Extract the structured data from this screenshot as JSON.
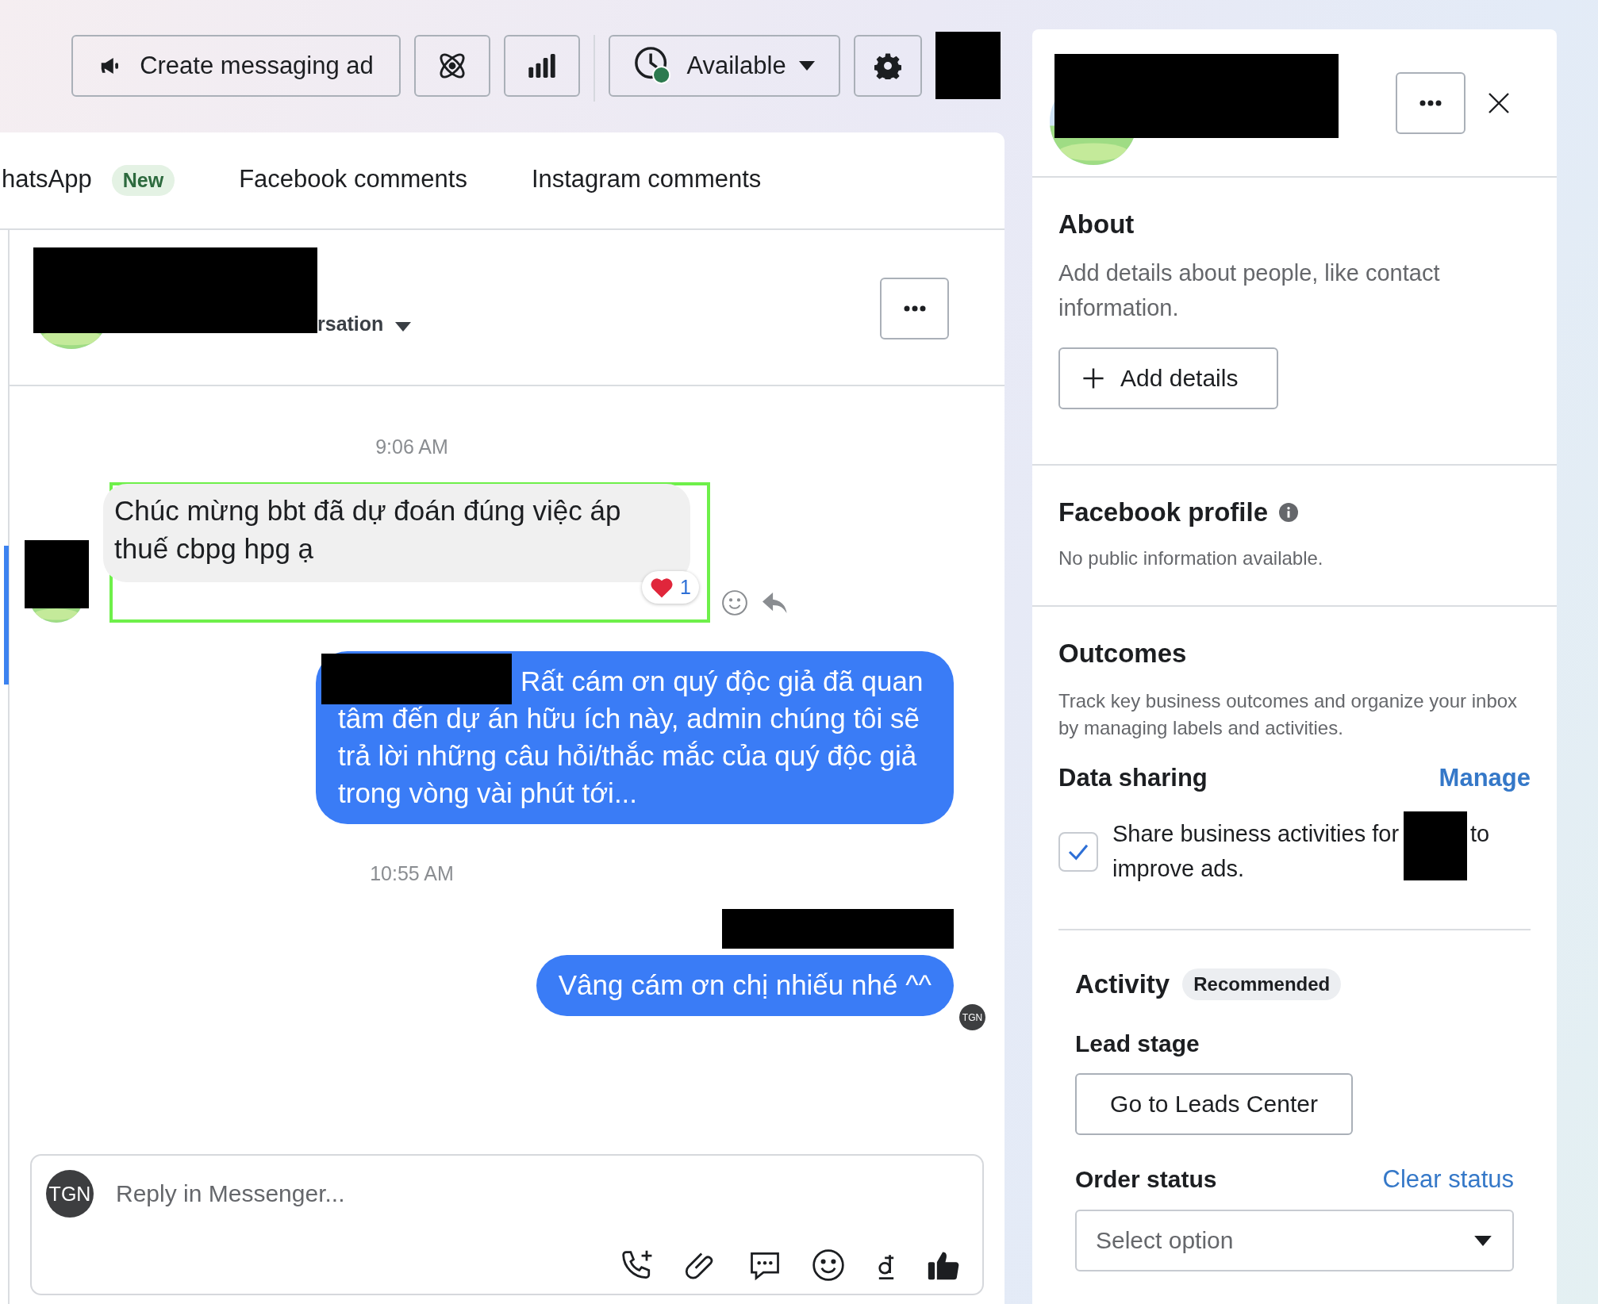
{
  "toolbar": {
    "create_ad_button": "Create messaging ad",
    "status_button": {
      "label": "Available",
      "online": true
    }
  },
  "tabs": [
    {
      "label": "hatsApp",
      "badge": "New",
      "selected": false
    },
    {
      "label": "Facebook comments",
      "selected": false
    },
    {
      "label": "Instagram comments",
      "selected": false
    }
  ],
  "conversation": {
    "subtitle": "rsation"
  },
  "messages": [
    {
      "kind": "time",
      "text": "9:06 AM"
    },
    {
      "kind": "incoming",
      "text": "Chúc mừng bbt đã dự đoán đúng việc áp thuế cbpg hpg ạ",
      "highlighted": true,
      "reaction_count": "1"
    },
    {
      "kind": "outgoing",
      "text": "Rất cám ơn quý độc giả đã quan tâm đến dự án hữu ích này, admin chúng tôi sẽ trả lời những câu hỏi/thắc mắc của quý độc giả trong vòng vài phút tới..."
    },
    {
      "kind": "time",
      "text": "10:55 AM"
    },
    {
      "kind": "outgoing",
      "text": "Vâng cám ơn chị nhiếu nhé ^^",
      "avatar": "TGN"
    }
  ],
  "composer": {
    "avatar": "TGN",
    "placeholder": "Reply in Messenger..."
  },
  "profile_panel": {
    "about": {
      "title": "About",
      "description": "Add details about people, like contact information.",
      "button": "Add details"
    },
    "facebook_profile": {
      "title": "Facebook profile",
      "description": "No public information available."
    },
    "outcomes": {
      "title": "Outcomes",
      "description": "Track key business outcomes and organize your inbox by managing labels and activities.",
      "data_sharing": {
        "title": "Data sharing",
        "link": "Manage",
        "checkbox": {
          "label_before": "Share business activities for",
          "label_after": "to",
          "label_continued": "improve ads.",
          "checked": true
        }
      }
    },
    "activity": {
      "title": "Activity",
      "badge": "Recommended",
      "lead_stage": {
        "title": "Lead stage",
        "button": "Go to Leads Center"
      },
      "order_status": {
        "title": "Order status",
        "link": "Clear status",
        "placeholder": "Select option"
      }
    }
  }
}
